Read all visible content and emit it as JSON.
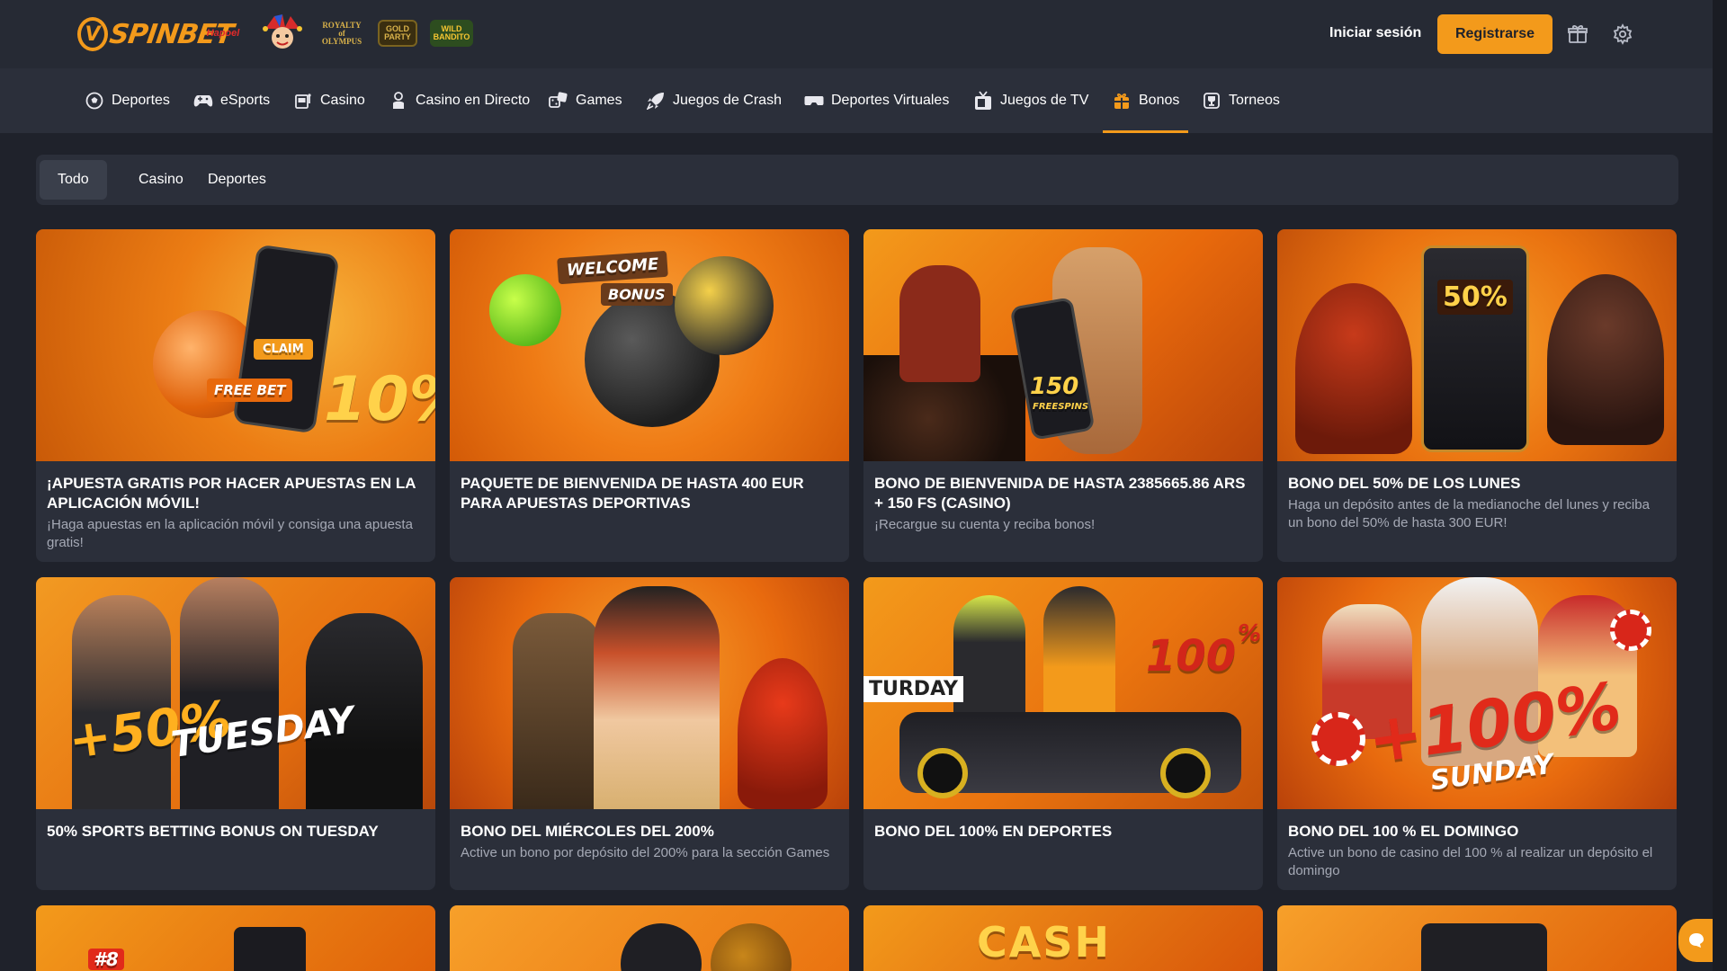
{
  "brand": {
    "name": "SPINBET",
    "accent": "#f39a1b"
  },
  "header": {
    "partners": [
      "Hapoel",
      "Joker",
      "ROYALTY of OLYMPUS",
      "GOLD PARTY",
      "WILD BANDITO"
    ],
    "login_label": "Iniciar sesión",
    "register_label": "Registrarse"
  },
  "nav": {
    "items": [
      {
        "label": "Deportes",
        "icon": "soccer-ball-icon"
      },
      {
        "label": "eSports",
        "icon": "gamepad-icon"
      },
      {
        "label": "Casino",
        "icon": "slot-machine-icon"
      },
      {
        "label": "Casino en Directo",
        "icon": "dealer-icon"
      },
      {
        "label": "Games",
        "icon": "dice-icon"
      },
      {
        "label": "Juegos de Crash",
        "icon": "rocket-icon"
      },
      {
        "label": "Deportes Virtuales",
        "icon": "vr-headset-icon"
      },
      {
        "label": "Juegos de TV",
        "icon": "tv-icon"
      },
      {
        "label": "Bonos",
        "icon": "gift-icon",
        "active": true
      },
      {
        "label": "Torneos",
        "icon": "trophy-icon"
      }
    ]
  },
  "filters": {
    "tabs": [
      "Todo",
      "Casino",
      "Deportes"
    ],
    "active": "Todo"
  },
  "cards": [
    {
      "title": "¡APUESTA GRATIS POR HACER APUESTAS EN LA APLICACIÓN MÓVIL!",
      "desc": "¡Haga apuestas en la aplicación móvil y consiga una apuesta gratis!",
      "banner": [
        "FREE BET",
        "10%",
        "CLAIM"
      ]
    },
    {
      "title": "PAQUETE DE BIENVENIDA DE HASTA 400 EUR PARA APUESTAS DEPORTIVAS",
      "desc": "",
      "banner": [
        "WELCOME",
        "BONUS"
      ]
    },
    {
      "title": "BONO DE BIENVENIDA DE HASTA 2385665.86 ARS + 150 FS (CASINO)",
      "desc": "¡Recargue su cuenta y reciba bonos!",
      "banner": [
        "150",
        "FREESPINS"
      ]
    },
    {
      "title": "BONO DEL 50% DE LOS LUNES",
      "desc": "Haga un depósito antes de la medianoche del lunes y reciba un bono del 50% de hasta 300 EUR!",
      "banner": [
        "50%"
      ]
    },
    {
      "title": "50% SPORTS BETTING BONUS ON TUESDAY",
      "desc": "",
      "banner": [
        "+50%",
        "TUESDAY"
      ]
    },
    {
      "title": "BONO DEL MIÉRCOLES DEL 200%",
      "desc": "Active un bono por depósito del 200% para la sección Games",
      "banner": []
    },
    {
      "title": "BONO DEL 100% EN DEPORTES",
      "desc": "",
      "banner": [
        "100",
        "%",
        "TURDAY"
      ]
    },
    {
      "title": "BONO DEL 100 % EL DOMINGO",
      "desc": "Active un bono de casino del 100 % al realizar un depósito el domingo",
      "banner": [
        "+100%",
        "SUNDAY"
      ]
    },
    {
      "title": "",
      "desc": "",
      "banner": [
        "#8"
      ]
    },
    {
      "title": "",
      "desc": "",
      "banner": []
    },
    {
      "title": "",
      "desc": "",
      "banner": [
        "CASH"
      ]
    },
    {
      "title": "",
      "desc": "",
      "banner": []
    }
  ]
}
